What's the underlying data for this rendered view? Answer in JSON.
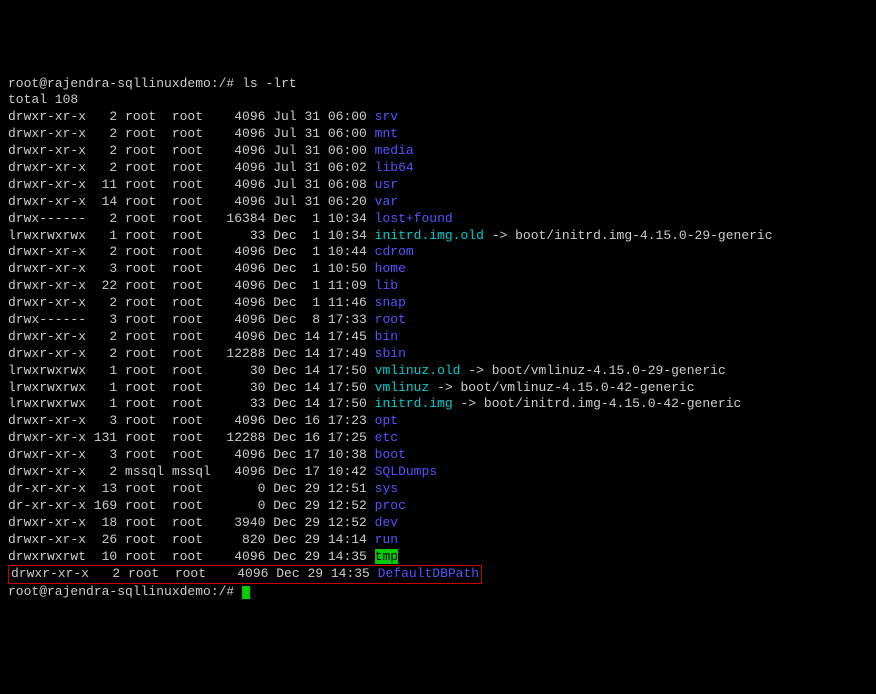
{
  "prompt1": "root@rajendra-sqllinuxdemo:/#",
  "command1": "ls -lrt",
  "total_line": "total 108",
  "entries": [
    {
      "perms": "drwxr-xr-x",
      "links": "2",
      "owner": "root",
      "group": "root",
      "size": "4096",
      "date": "Jul 31 06:00",
      "name": "srv",
      "type": "dir"
    },
    {
      "perms": "drwxr-xr-x",
      "links": "2",
      "owner": "root",
      "group": "root",
      "size": "4096",
      "date": "Jul 31 06:00",
      "name": "mnt",
      "type": "dir"
    },
    {
      "perms": "drwxr-xr-x",
      "links": "2",
      "owner": "root",
      "group": "root",
      "size": "4096",
      "date": "Jul 31 06:00",
      "name": "media",
      "type": "dir"
    },
    {
      "perms": "drwxr-xr-x",
      "links": "2",
      "owner": "root",
      "group": "root",
      "size": "4096",
      "date": "Jul 31 06:02",
      "name": "lib64",
      "type": "dir"
    },
    {
      "perms": "drwxr-xr-x",
      "links": "11",
      "owner": "root",
      "group": "root",
      "size": "4096",
      "date": "Jul 31 06:08",
      "name": "usr",
      "type": "dir"
    },
    {
      "perms": "drwxr-xr-x",
      "links": "14",
      "owner": "root",
      "group": "root",
      "size": "4096",
      "date": "Jul 31 06:20",
      "name": "var",
      "type": "dir"
    },
    {
      "perms": "drwx------",
      "links": "2",
      "owner": "root",
      "group": "root",
      "size": "16384",
      "date": "Dec  1 10:34",
      "name": "lost+found",
      "type": "dir"
    },
    {
      "perms": "lrwxrwxrwx",
      "links": "1",
      "owner": "root",
      "group": "root",
      "size": "33",
      "date": "Dec  1 10:34",
      "name": "initrd.img.old",
      "type": "link",
      "target": "boot/initrd.img-4.15.0-29-generic"
    },
    {
      "perms": "drwxr-xr-x",
      "links": "2",
      "owner": "root",
      "group": "root",
      "size": "4096",
      "date": "Dec  1 10:44",
      "name": "cdrom",
      "type": "dir"
    },
    {
      "perms": "drwxr-xr-x",
      "links": "3",
      "owner": "root",
      "group": "root",
      "size": "4096",
      "date": "Dec  1 10:50",
      "name": "home",
      "type": "dir"
    },
    {
      "perms": "drwxr-xr-x",
      "links": "22",
      "owner": "root",
      "group": "root",
      "size": "4096",
      "date": "Dec  1 11:09",
      "name": "lib",
      "type": "dir"
    },
    {
      "perms": "drwxr-xr-x",
      "links": "2",
      "owner": "root",
      "group": "root",
      "size": "4096",
      "date": "Dec  1 11:46",
      "name": "snap",
      "type": "dir"
    },
    {
      "perms": "drwx------",
      "links": "3",
      "owner": "root",
      "group": "root",
      "size": "4096",
      "date": "Dec  8 17:33",
      "name": "root",
      "type": "dir"
    },
    {
      "perms": "drwxr-xr-x",
      "links": "2",
      "owner": "root",
      "group": "root",
      "size": "4096",
      "date": "Dec 14 17:45",
      "name": "bin",
      "type": "dir"
    },
    {
      "perms": "drwxr-xr-x",
      "links": "2",
      "owner": "root",
      "group": "root",
      "size": "12288",
      "date": "Dec 14 17:49",
      "name": "sbin",
      "type": "dir"
    },
    {
      "perms": "lrwxrwxrwx",
      "links": "1",
      "owner": "root",
      "group": "root",
      "size": "30",
      "date": "Dec 14 17:50",
      "name": "vmlinuz.old",
      "type": "link",
      "target": "boot/vmlinuz-4.15.0-29-generic"
    },
    {
      "perms": "lrwxrwxrwx",
      "links": "1",
      "owner": "root",
      "group": "root",
      "size": "30",
      "date": "Dec 14 17:50",
      "name": "vmlinuz",
      "type": "link",
      "target": "boot/vmlinuz-4.15.0-42-generic"
    },
    {
      "perms": "lrwxrwxrwx",
      "links": "1",
      "owner": "root",
      "group": "root",
      "size": "33",
      "date": "Dec 14 17:50",
      "name": "initrd.img",
      "type": "link",
      "target": "boot/initrd.img-4.15.0-42-generic"
    },
    {
      "perms": "drwxr-xr-x",
      "links": "3",
      "owner": "root",
      "group": "root",
      "size": "4096",
      "date": "Dec 16 17:23",
      "name": "opt",
      "type": "dir"
    },
    {
      "perms": "drwxr-xr-x",
      "links": "131",
      "owner": "root",
      "group": "root",
      "size": "12288",
      "date": "Dec 16 17:25",
      "name": "etc",
      "type": "dir"
    },
    {
      "perms": "drwxr-xr-x",
      "links": "3",
      "owner": "root",
      "group": "root",
      "size": "4096",
      "date": "Dec 17 10:38",
      "name": "boot",
      "type": "dir"
    },
    {
      "perms": "drwxr-xr-x",
      "links": "2",
      "owner": "mssql",
      "group": "mssql",
      "size": "4096",
      "date": "Dec 17 10:42",
      "name": "SQLDumps",
      "type": "dir"
    },
    {
      "perms": "dr-xr-xr-x",
      "links": "13",
      "owner": "root",
      "group": "root",
      "size": "0",
      "date": "Dec 29 12:51",
      "name": "sys",
      "type": "dir"
    },
    {
      "perms": "dr-xr-xr-x",
      "links": "169",
      "owner": "root",
      "group": "root",
      "size": "0",
      "date": "Dec 29 12:52",
      "name": "proc",
      "type": "dir"
    },
    {
      "perms": "drwxr-xr-x",
      "links": "18",
      "owner": "root",
      "group": "root",
      "size": "3940",
      "date": "Dec 29 12:52",
      "name": "dev",
      "type": "dir"
    },
    {
      "perms": "drwxr-xr-x",
      "links": "26",
      "owner": "root",
      "group": "root",
      "size": "820",
      "date": "Dec 29 14:14",
      "name": "run",
      "type": "dir"
    },
    {
      "perms": "drwxrwxrwt",
      "links": "10",
      "owner": "root",
      "group": "root",
      "size": "4096",
      "date": "Dec 29 14:35",
      "name": "tmp",
      "type": "sticky"
    },
    {
      "perms": "drwxr-xr-x",
      "links": "2",
      "owner": "root",
      "group": "root",
      "size": "4096",
      "date": "Dec 29 14:35",
      "name": "DefaultDBPath",
      "type": "dir",
      "highlight": true
    }
  ],
  "prompt2": "root@rajendra-sqllinuxdemo:/#"
}
